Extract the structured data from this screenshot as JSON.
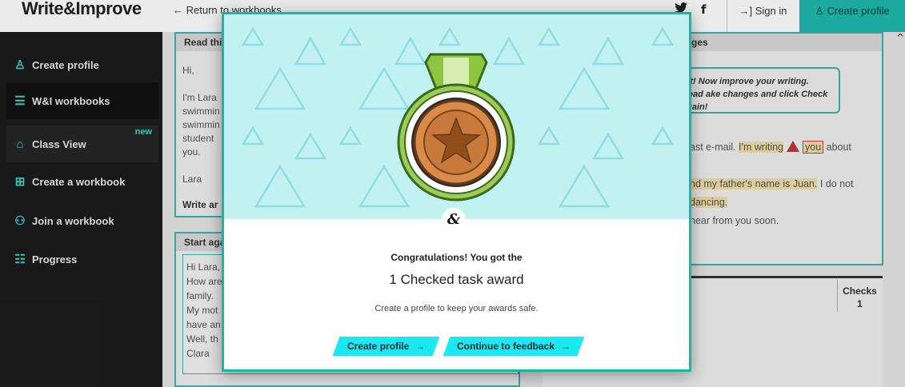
{
  "header": {
    "logo": "Write&Improve",
    "return_link": "← Return to workbooks",
    "twitter_icon": "twitter-icon",
    "facebook_glyph": "f",
    "signin_label": "→] Sign in",
    "create_profile_label": "♙ Create profile"
  },
  "sidebar": {
    "items": [
      {
        "icon": "user-plus-icon",
        "glyph": "♙",
        "label": "Create profile"
      },
      {
        "icon": "list-icon",
        "glyph": "☰",
        "label": "W&I workbooks"
      },
      {
        "icon": "graduation-cap-icon",
        "glyph": "⌂",
        "label": "Class View",
        "badge": "new"
      },
      {
        "icon": "file-plus-icon",
        "glyph": "⊞",
        "label": "Create a workbook"
      },
      {
        "icon": "group-icon",
        "glyph": "⚇",
        "label": "Join a workbook"
      },
      {
        "icon": "progress-icon",
        "glyph": "☷",
        "label": "Progress"
      }
    ]
  },
  "background": {
    "left_panel_head": "Read thi",
    "left_lines": [
      "Hi,",
      "",
      "I'm Lara",
      "swimmin",
      "swimmin",
      "student",
      "you.",
      "",
      "Lara"
    ],
    "write_label": "Write ar",
    "start_again_label": "Start aga",
    "textarea_lines": [
      "Hi Lara,",
      "How are",
      "family.",
      "My mot",
      "have an",
      "Well, th",
      "Clara"
    ],
    "right_panel_head": "ges",
    "callout_text": "art! Now improve your writing. Read ake changes and click Check again!",
    "right_line1_a": "ast e-mail. ",
    "right_line1_hl": "I'm writing",
    "right_line1_word": "you",
    "right_line1_b": " about",
    "right_line2_hl": "nd my father's name is Juan.",
    "right_line2_b": " I do not",
    "right_line3_hl": "dancing.",
    "right_line4": "hear from you soon.",
    "checks_label": "Checks",
    "checks_value": "1"
  },
  "modal": {
    "badge_symbol": "&",
    "congrats": "Congratulations! You got the",
    "award_name": "1 Checked task award",
    "subtext": "Create a profile to keep your awards safe.",
    "create_profile_button": "Create profile",
    "continue_button": "Continue to feedback",
    "arrow": "→",
    "medal_icon": "bronze-star-medal-icon",
    "colors": {
      "top_bg": "#c2f1f1",
      "button_bg": "#1de8f0",
      "border": "#17b6ac",
      "medal_bronze": "#d98b4c"
    }
  }
}
